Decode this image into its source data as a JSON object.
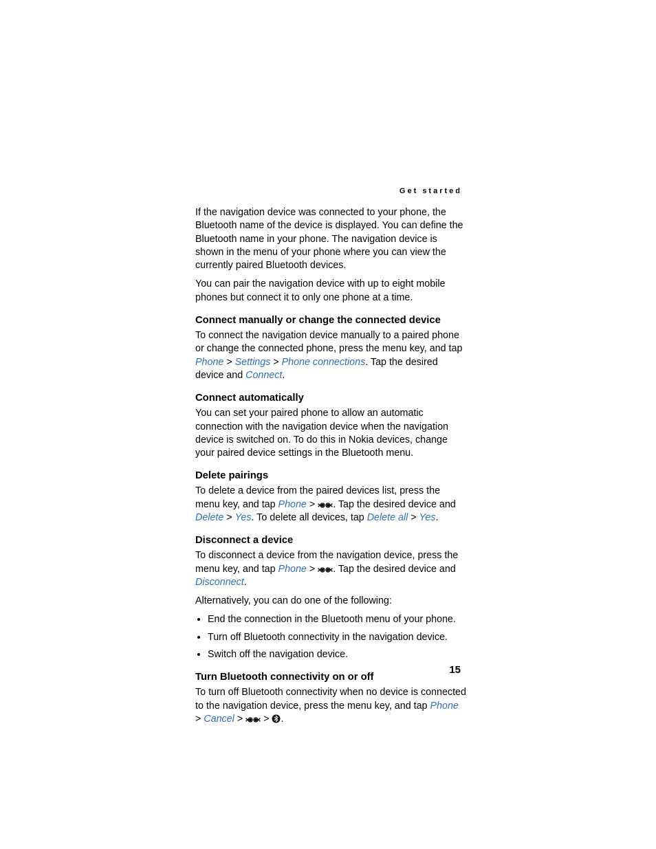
{
  "header": {
    "running_title": "Get started"
  },
  "intro": {
    "p1": "If the navigation device was connected to your phone, the Bluetooth name of the device is displayed. You can define the Bluetooth name in your phone. The navigation device is shown in the menu of your phone where you can view the currently paired Bluetooth devices.",
    "p2": "You can pair the navigation device with up to eight mobile phones but connect it to only one phone at a time."
  },
  "sec1": {
    "heading": "Connect manually or change the connected device",
    "p1a": "To connect the navigation device manually to a paired phone or change the connected phone, press the menu key, and tap ",
    "link_phone": "Phone",
    "gt1": " > ",
    "link_settings": "Settings",
    "gt2": " > ",
    "link_phoneconn": "Phone connections",
    "p1b": ". Tap the desired device and ",
    "link_connect": "Connect",
    "p1c": "."
  },
  "sec2": {
    "heading": "Connect automatically",
    "p1": "You can set your paired phone to allow an automatic connection with the navigation device when the navigation device is switched on. To do this in Nokia devices, change your paired device settings in the Bluetooth menu."
  },
  "sec3": {
    "heading": "Delete pairings",
    "p1a": "To delete a device from the paired devices list, press the menu key, and tap ",
    "link_phone": "Phone",
    "gt1": " > ",
    "p1b": ". Tap the desired device and ",
    "link_delete": "Delete",
    "gt2": " > ",
    "link_yes": "Yes",
    "p1c": ". To delete all devices, tap ",
    "link_deleteall": "Delete all",
    "gt3": " > ",
    "link_yes2": "Yes",
    "p1d": "."
  },
  "sec4": {
    "heading": "Disconnect a device",
    "p1a": "To disconnect a device from the navigation device, press the menu key, and tap ",
    "link_phone": "Phone",
    "gt1": " > ",
    "p1b": ". Tap the desired device and ",
    "link_disconnect": "Disconnect",
    "p1c": ".",
    "p2": "Alternatively, you can do one of the following:",
    "bullets": {
      "b1": "End the connection in the Bluetooth menu of your phone.",
      "b2": "Turn off Bluetooth connectivity in the navigation device.",
      "b3": "Switch off the navigation device."
    }
  },
  "sec5": {
    "heading": "Turn Bluetooth connectivity on or off",
    "p1a": "To turn off Bluetooth connectivity when no device is connected to the navigation device, press the menu key, and tap ",
    "link_phone": "Phone",
    "gt1": " > ",
    "link_cancel": "Cancel",
    "gt2": " > ",
    "gt3": " > ",
    "p1b": "."
  },
  "page_number": "15"
}
